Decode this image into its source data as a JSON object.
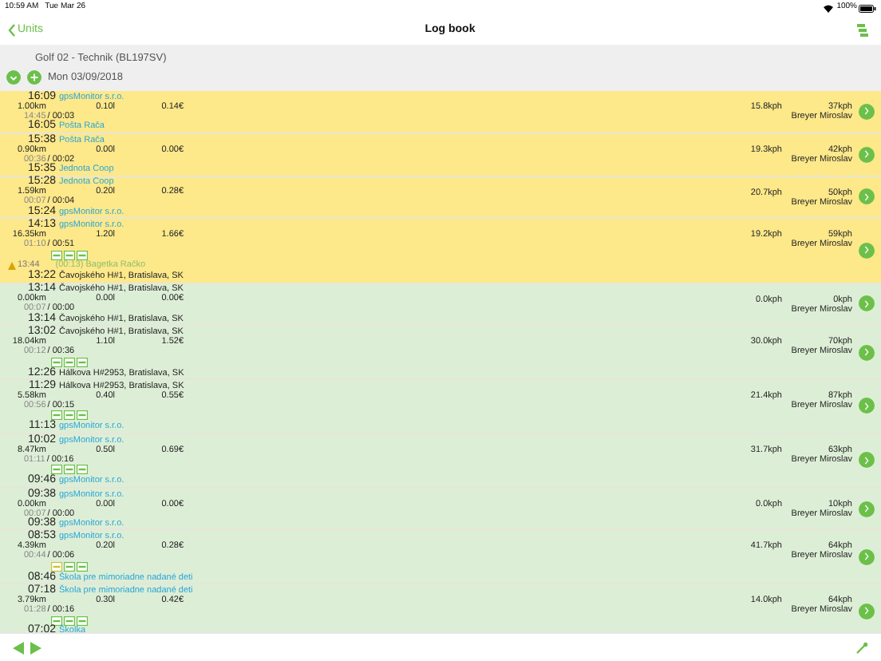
{
  "status_bar": {
    "time": "10:59 AM",
    "date": "Tue Mar 26",
    "battery": "100%"
  },
  "nav": {
    "back": "Units",
    "title": "Log book"
  },
  "header": {
    "vehicle": "Golf 02 - Technik (BL197SV)",
    "date": "Mon 03/09/2018"
  },
  "trips": [
    {
      "color": "#fde88a",
      "end": {
        "time": "16:09",
        "place": "gpsMonitor s.r.o.",
        "kind": "poi"
      },
      "distance": "1.00km",
      "fuel": "0.10l",
      "cost": "0.14€",
      "duration_1": "14:45",
      "duration_2": "/ 00:03",
      "start": {
        "time": "16:05",
        "place": "Pošta Rača",
        "kind": "poi"
      },
      "avg_speed": "15.8kph",
      "max_speed": "37kph",
      "driver": "Breyer Miroslav"
    },
    {
      "color": "#fde88a",
      "end": {
        "time": "15:38",
        "place": "Pošta Rača",
        "kind": "poi"
      },
      "distance": "0.90km",
      "fuel": "0.00l",
      "cost": "0.00€",
      "duration_1": "00:36",
      "duration_2": "/ 00:02",
      "start": {
        "time": "15:35",
        "place": "Jednota Coop",
        "kind": "poi"
      },
      "avg_speed": "19.3kph",
      "max_speed": "42kph",
      "driver": "Breyer Miroslav"
    },
    {
      "color": "#fde88a",
      "end": {
        "time": "15:28",
        "place": "Jednota Coop",
        "kind": "poi"
      },
      "distance": "1.59km",
      "fuel": "0.20l",
      "cost": "0.28€",
      "duration_1": "00:07",
      "duration_2": "/ 00:04",
      "start": {
        "time": "15:24",
        "place": "gpsMonitor s.r.o.",
        "kind": "poi"
      },
      "avg_speed": "20.7kph",
      "max_speed": "50kph",
      "driver": "Breyer Miroslav"
    },
    {
      "color": "#fde88a",
      "end": {
        "time": "14:13",
        "place": "gpsMonitor s.r.o.",
        "kind": "poi"
      },
      "distance": "16.35km",
      "fuel": "1.20l",
      "cost": "1.66€",
      "duration_1": "01:10",
      "duration_2": "/ 00:51",
      "badges": [
        {
          "color": "#6cc04a"
        },
        {
          "color": "#6cc04a"
        },
        {
          "color": "#6cc04a"
        }
      ],
      "stop": {
        "time": "13:44",
        "duration": "(00:13)",
        "place": "Bagetka Račko"
      },
      "start": {
        "time": "13:22",
        "place": "Čavojského H#1, Bratislava, SK",
        "kind": "address"
      },
      "avg_speed": "19.2kph",
      "max_speed": "59kph",
      "driver": "Breyer Miroslav"
    },
    {
      "color": "#ddeed6",
      "end": {
        "time": "13:14",
        "place": "Čavojského H#1, Bratislava, SK",
        "kind": "address"
      },
      "distance": "0.00km",
      "fuel": "0.00l",
      "cost": "0.00€",
      "duration_1": "00:07",
      "duration_2": "/ 00:00",
      "start": {
        "time": "13:14",
        "place": "Čavojského H#1, Bratislava, SK",
        "kind": "address"
      },
      "avg_speed": "0.0kph",
      "max_speed": "0kph",
      "driver": "Breyer Miroslav"
    },
    {
      "color": "#ddeed6",
      "end": {
        "time": "13:02",
        "place": "Čavojského H#1, Bratislava, SK",
        "kind": "address"
      },
      "distance": "18.04km",
      "fuel": "1.10l",
      "cost": "1.52€",
      "duration_1": "00:12",
      "duration_2": "/ 00:36",
      "badges": [
        {
          "color": "#6cc04a"
        },
        {
          "color": "#6cc04a"
        },
        {
          "color": "#6cc04a"
        }
      ],
      "start": {
        "time": "12:26",
        "place": "Hálkova H#2953, Bratislava, SK",
        "kind": "address"
      },
      "avg_speed": "30.0kph",
      "max_speed": "70kph",
      "driver": "Breyer Miroslav"
    },
    {
      "color": "#ddeed6",
      "end": {
        "time": "11:29",
        "place": "Hálkova H#2953, Bratislava, SK",
        "kind": "address"
      },
      "distance": "5.58km",
      "fuel": "0.40l",
      "cost": "0.55€",
      "duration_1": "00:56",
      "duration_2": "/ 00:15",
      "badges": [
        {
          "color": "#6cc04a"
        },
        {
          "color": "#6cc04a"
        },
        {
          "color": "#6cc04a"
        }
      ],
      "start": {
        "time": "11:13",
        "place": "gpsMonitor s.r.o.",
        "kind": "poi"
      },
      "avg_speed": "21.4kph",
      "max_speed": "87kph",
      "driver": "Breyer Miroslav"
    },
    {
      "color": "#ddeed6",
      "end": {
        "time": "10:02",
        "place": "gpsMonitor s.r.o.",
        "kind": "poi"
      },
      "distance": "8.47km",
      "fuel": "0.50l",
      "cost": "0.69€",
      "duration_1": "01:11",
      "duration_2": "/ 00:16",
      "badges": [
        {
          "color": "#6cc04a"
        },
        {
          "color": "#6cc04a"
        },
        {
          "color": "#6cc04a"
        }
      ],
      "start": {
        "time": "09:46",
        "place": "gpsMonitor s.r.o.",
        "kind": "poi"
      },
      "avg_speed": "31.7kph",
      "max_speed": "63kph",
      "driver": "Breyer Miroslav"
    },
    {
      "color": "#ddeed6",
      "end": {
        "time": "09:38",
        "place": "gpsMonitor s.r.o.",
        "kind": "poi"
      },
      "distance": "0.00km",
      "fuel": "0.00l",
      "cost": "0.00€",
      "duration_1": "00:07",
      "duration_2": "/ 00:00",
      "start": {
        "time": "09:38",
        "place": "gpsMonitor s.r.o.",
        "kind": "poi"
      },
      "avg_speed": "0.0kph",
      "max_speed": "10kph",
      "driver": "Breyer Miroslav"
    },
    {
      "color": "#ddeed6",
      "end": {
        "time": "08:53",
        "place": "gpsMonitor s.r.o.",
        "kind": "poi"
      },
      "distance": "4.39km",
      "fuel": "0.20l",
      "cost": "0.28€",
      "duration_1": "00:44",
      "duration_2": "/ 00:06",
      "badges": [
        {
          "color": "#c8c43a"
        },
        {
          "color": "#6cc04a"
        },
        {
          "color": "#6cc04a"
        }
      ],
      "start": {
        "time": "08:46",
        "place": "Škola pre mimoriadne nadané deti",
        "kind": "poi"
      },
      "avg_speed": "41.7kph",
      "max_speed": "64kph",
      "driver": "Breyer Miroslav"
    },
    {
      "color": "#ddeed6",
      "end": {
        "time": "07:18",
        "place": "Škola pre mimoriadne nadané deti",
        "kind": "poi"
      },
      "distance": "3.79km",
      "fuel": "0.30l",
      "cost": "0.42€",
      "duration_1": "01:28",
      "duration_2": "/ 00:16",
      "badges": [
        {
          "color": "#6cc04a"
        },
        {
          "color": "#6cc04a"
        },
        {
          "color": "#6cc04a"
        }
      ],
      "start": {
        "time": "07:02",
        "place": "Školka",
        "kind": "poi"
      },
      "avg_speed": "14.0kph",
      "max_speed": "64kph",
      "driver": "Breyer Miroslav"
    }
  ]
}
